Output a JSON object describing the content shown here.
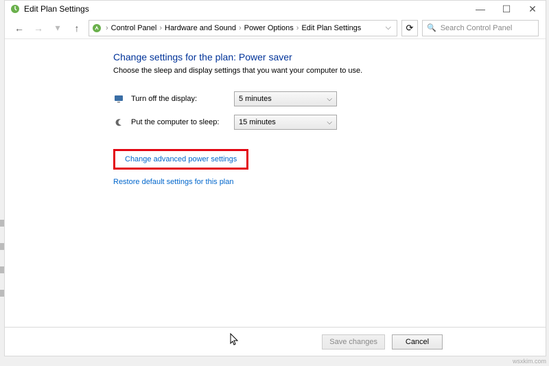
{
  "window": {
    "title": "Edit Plan Settings",
    "sys": {
      "minimize": "—",
      "maximize": "☐",
      "close": "✕"
    }
  },
  "nav": {
    "back": "←",
    "forward": "→",
    "up": "↑",
    "breadcrumbs": [
      "Control Panel",
      "Hardware and Sound",
      "Power Options",
      "Edit Plan Settings"
    ],
    "dropdown": "⌵",
    "refresh": "⟳",
    "search_placeholder": "Search Control Panel",
    "search_icon": "🔍"
  },
  "page": {
    "title": "Change settings for the plan: Power saver",
    "description": "Choose the sleep and display settings that you want your computer to use."
  },
  "settings": {
    "display": {
      "label": "Turn off the display:",
      "value": "5 minutes"
    },
    "sleep": {
      "label": "Put the computer to sleep:",
      "value": "15 minutes"
    }
  },
  "links": {
    "advanced": "Change advanced power settings",
    "restore": "Restore default settings for this plan"
  },
  "footer": {
    "save": "Save changes",
    "cancel": "Cancel"
  },
  "watermark": "wsxkim.com",
  "icons": {
    "power": "⚡"
  }
}
